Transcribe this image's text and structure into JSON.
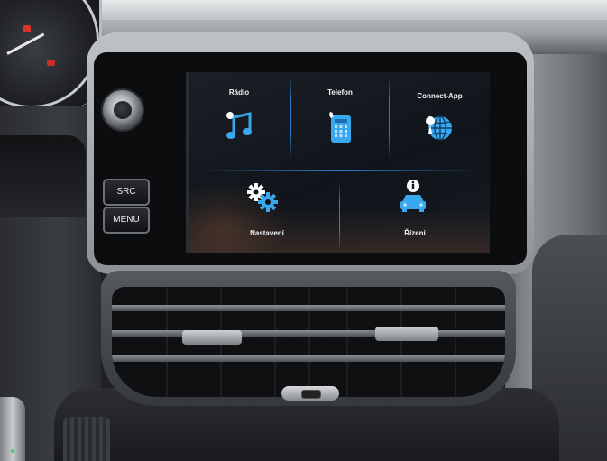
{
  "hardware_buttons": {
    "src_label": "SRC",
    "menu_label": "MENU"
  },
  "screen": {
    "tiles": [
      {
        "label": "Rádio",
        "icon": "music-note-icon"
      },
      {
        "label": "Telefon",
        "icon": "phone-icon"
      },
      {
        "label": "Connect-App",
        "icon": "globe-icon"
      },
      {
        "label": "Nastavení",
        "icon": "gears-icon"
      },
      {
        "label": "Řízení",
        "icon": "car-info-icon"
      }
    ],
    "accent_color": "#2e9ee8",
    "background_color": "#12171d"
  }
}
